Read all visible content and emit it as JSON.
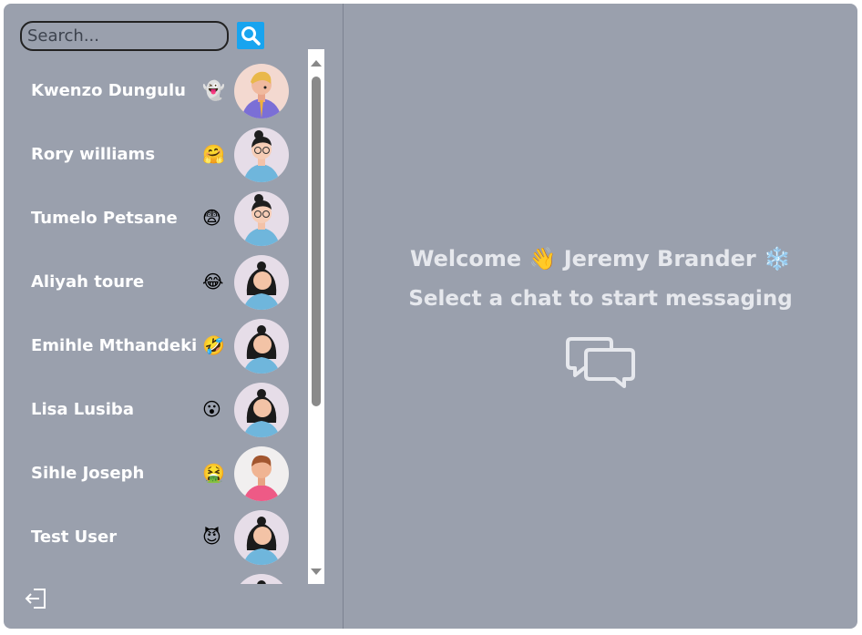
{
  "search": {
    "placeholder": "Search..."
  },
  "users": [
    {
      "name": "Kwenzo Dungulu",
      "emoji": "👻"
    },
    {
      "name": "Rory williams",
      "emoji": "🤗"
    },
    {
      "name": "Tumelo Petsane",
      "emoji": "😨"
    },
    {
      "name": "Aliyah toure",
      "emoji": "😂"
    },
    {
      "name": "Emihle Mthandeki",
      "emoji": "🤣"
    },
    {
      "name": "Lisa Lusiba",
      "emoji": "😮"
    },
    {
      "name": "Sihle Joseph",
      "emoji": "🤮"
    },
    {
      "name": "Test User",
      "emoji": "😈"
    }
  ],
  "main": {
    "welcome_prefix": "Welcome",
    "wave_emoji": "👋",
    "user_name": "Jeremy Brander",
    "user_emoji": "❄️",
    "subtitle": "Select a chat to start messaging"
  },
  "icons": {
    "search": "search-icon",
    "logout": "logout-icon",
    "chat": "chat-bubbles-icon"
  },
  "colors": {
    "panel": "#9aa0ad",
    "accent": "#18a4ef",
    "text": "#ffffff"
  }
}
